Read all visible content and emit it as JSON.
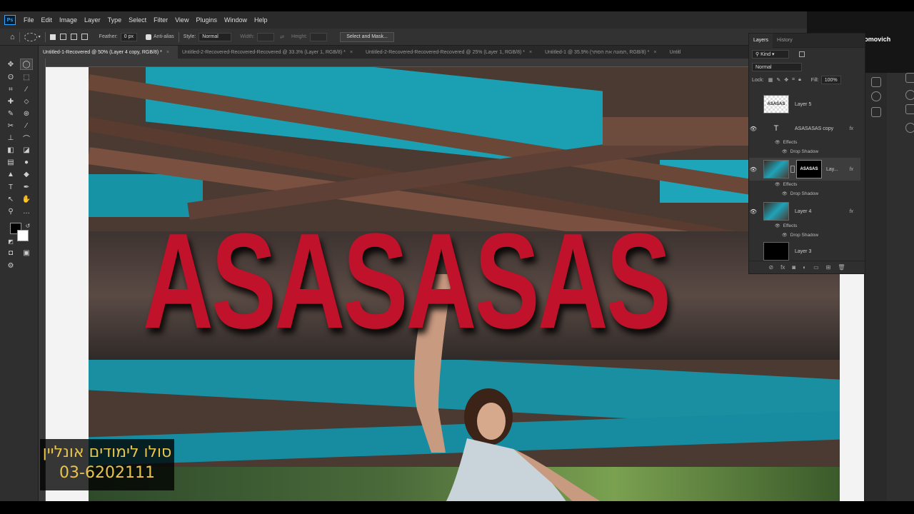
{
  "menu": {
    "logo": "Ps",
    "items": [
      "File",
      "Edit",
      "Image",
      "Layer",
      "Type",
      "Select",
      "Filter",
      "View",
      "Plugins",
      "Window",
      "Help"
    ]
  },
  "options": {
    "feather_label": "Feather:",
    "feather_value": "0 px",
    "antialias_label": "Anti-alias",
    "style_label": "Style:",
    "style_value": "Normal",
    "width_label": "Width:",
    "height_label": "Height:",
    "select_mask_label": "Select and Mask..."
  },
  "tabs": [
    {
      "label": "Untitled-1-Recovered @ 50% (Layer 4 copy, RGB/8) *"
    },
    {
      "label": "Untitled-2-Recovered-Recovered-Recovered @ 33.3% (Layer 1, RGB/8) *"
    },
    {
      "label": "Untitled-2-Recovered-Recovered-Recovered @ 25% (Layer 1, RGB/8) *"
    },
    {
      "label": "Untitled-1 @ 35.9% (תמונה את הסתר, RGB/8) *"
    },
    {
      "label": "Untitl"
    }
  ],
  "canvas": {
    "headline": "ASASASAS"
  },
  "promo": {
    "line1": "סולו לימודים אונליין",
    "line2": "03-6202111"
  },
  "author": "hanoch solomovich",
  "layers_panel": {
    "tab_layers": "Layers",
    "tab_history": "History",
    "kind_label": "Kind",
    "blend_mode": "Normal",
    "lock_label": "Lock:",
    "fill_label": "Fill:",
    "fill_value": "100%",
    "layers": [
      {
        "name": "Layer 5"
      },
      {
        "name": "ASASASAS copy"
      },
      {
        "name": "Lay..."
      },
      {
        "name": "Layer 4"
      },
      {
        "name": "Layer 3"
      }
    ],
    "effects_label": "Effects",
    "drop_shadow_label": "Drop Shadow",
    "fx_label": "fx",
    "thumb_text": "ASASAS"
  },
  "colors": {
    "headline_red": "#c0122a",
    "teal": "#1fa3b8",
    "promo_yellow": "#e8c44a"
  }
}
